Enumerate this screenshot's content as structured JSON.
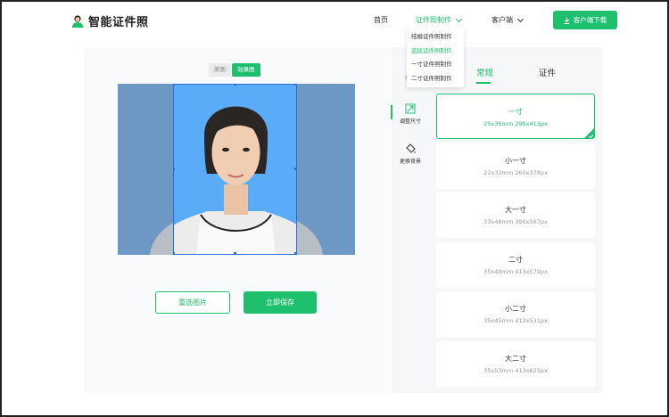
{
  "brand": {
    "name": "智能证件照",
    "accent": "#1ec06e"
  },
  "nav": {
    "home": "首页",
    "make": "证件照制作",
    "client": "客户端",
    "download": "客户端下载"
  },
  "dropdown": {
    "items": [
      {
        "label": "结婚证件照制作",
        "active": false
      },
      {
        "label": "蓝底证件照制作",
        "active": true
      },
      {
        "label": "一寸证件照制作",
        "active": false
      },
      {
        "label": "二寸证件照制作",
        "active": false
      }
    ]
  },
  "preview": {
    "toggle_original": "原图",
    "toggle_effect": "效果图",
    "background_color": "#5aabf8"
  },
  "actions": {
    "reselect": "重选图片",
    "save": "立即保存"
  },
  "tools": {
    "partial_label": "手动",
    "resize": "调整尺寸",
    "background": "更换背景"
  },
  "tabs": {
    "normal": "常规",
    "id": "证件"
  },
  "sizes": [
    {
      "name": "一寸",
      "dims": "25x35mm 295x413px",
      "active": true
    },
    {
      "name": "小一寸",
      "dims": "22x32mm 260x378px",
      "active": false
    },
    {
      "name": "大一寸",
      "dims": "33x48mm 390x567px",
      "active": false
    },
    {
      "name": "二寸",
      "dims": "35x49mm 413x579px",
      "active": false
    },
    {
      "name": "小二寸",
      "dims": "35x45mm 413x531px",
      "active": false
    },
    {
      "name": "大二寸",
      "dims": "35x53mm 413x625px",
      "active": false
    }
  ]
}
